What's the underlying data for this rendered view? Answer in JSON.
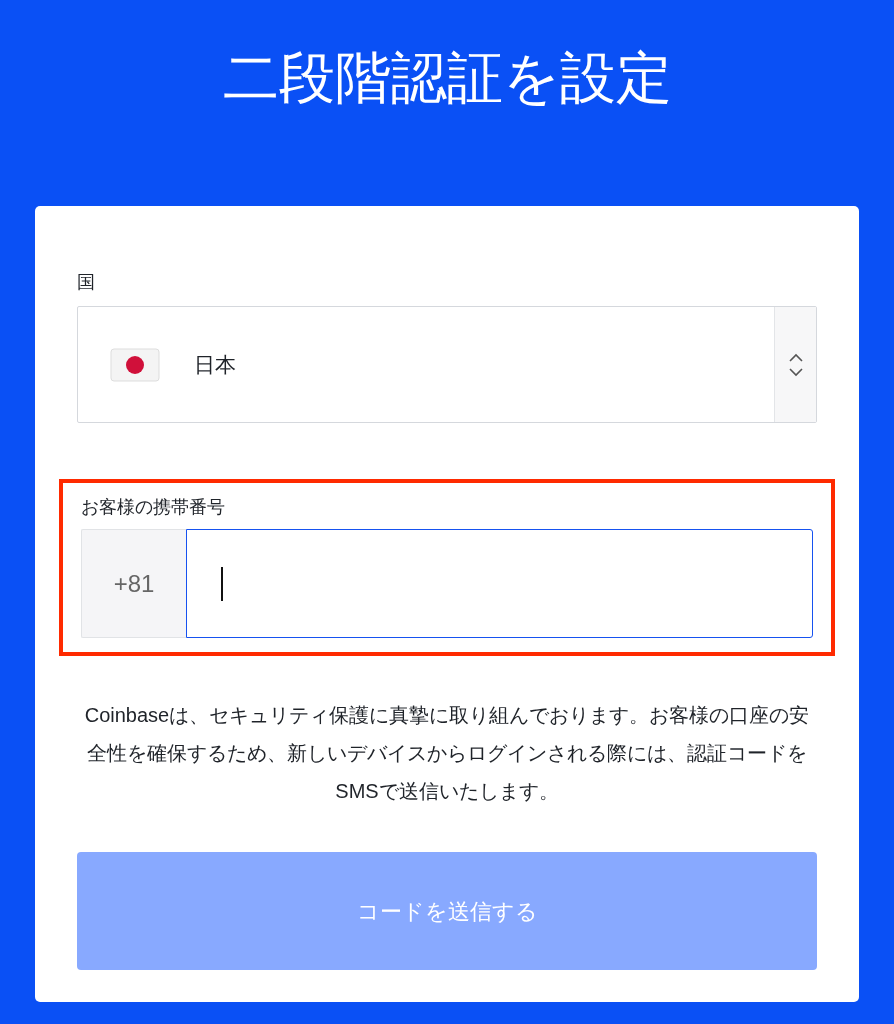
{
  "title": "二段階認証を設定",
  "country": {
    "label": "国",
    "value": "日本"
  },
  "phone": {
    "label": "お客様の携帯番号",
    "prefix": "+81",
    "focused": true,
    "highlighted": true
  },
  "description": "Coinbaseは、セキュリティ保護に真摯に取り組んでおります。お客様の口座の安全性を確保するため、新しいデバイスからログインされる際には、認証コードをSMSで送信いたします。",
  "submit": {
    "label": "コードを送信する",
    "disabled": true
  }
}
